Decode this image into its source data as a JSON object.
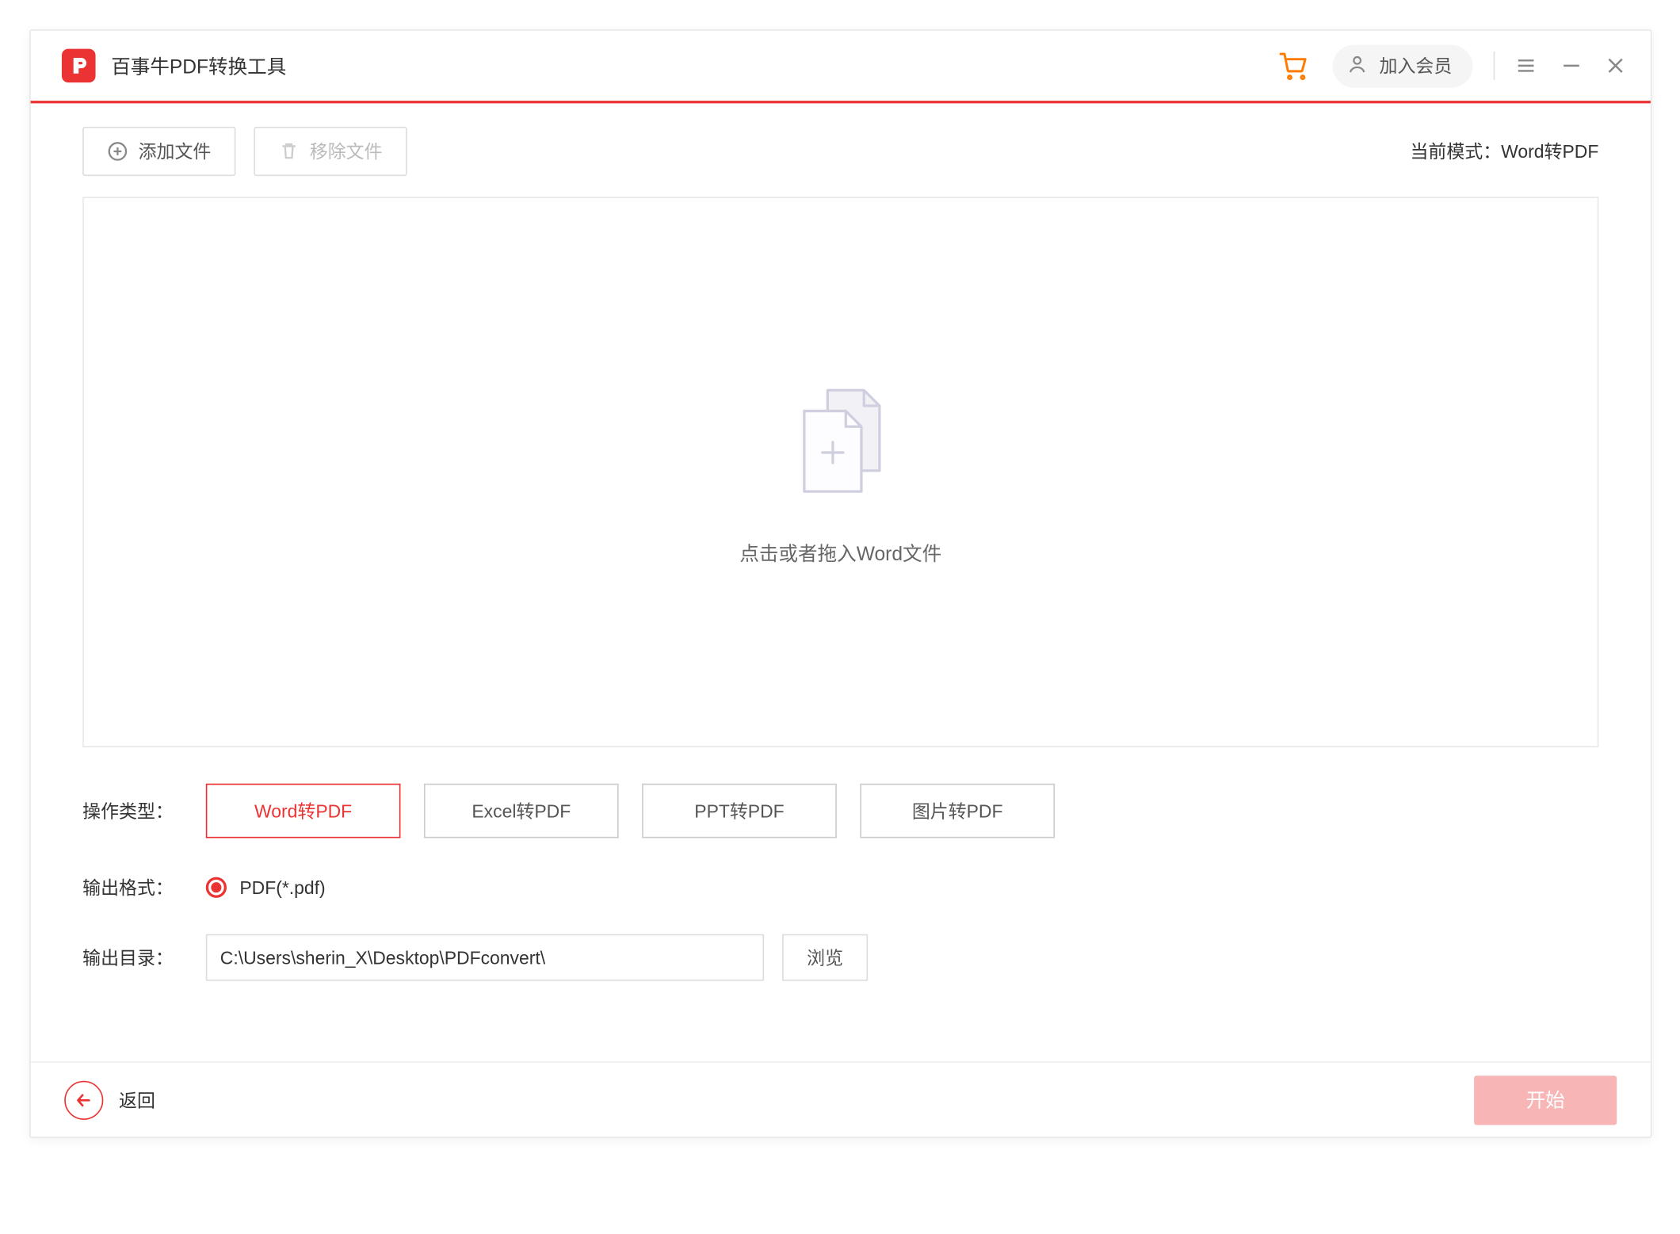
{
  "titlebar": {
    "app_title": "百事牛PDF转换工具",
    "member_label": "加入会员"
  },
  "toolbar": {
    "add_file": "添加文件",
    "remove_file": "移除文件",
    "mode_prefix": "当前模式：",
    "mode_value": "Word转PDF"
  },
  "drop": {
    "hint": "点击或者拖入Word文件"
  },
  "options": {
    "type_label": "操作类型：",
    "types": [
      "Word转PDF",
      "Excel转PDF",
      "PPT转PDF",
      "图片转PDF"
    ],
    "format_label": "输出格式：",
    "format_value": "PDF(*.pdf)",
    "outdir_label": "输出目录：",
    "outdir_value": "C:\\Users\\sherin_X\\Desktop\\PDFconvert\\",
    "browse_label": "浏览"
  },
  "footer": {
    "back_label": "返回",
    "start_label": "开始"
  }
}
